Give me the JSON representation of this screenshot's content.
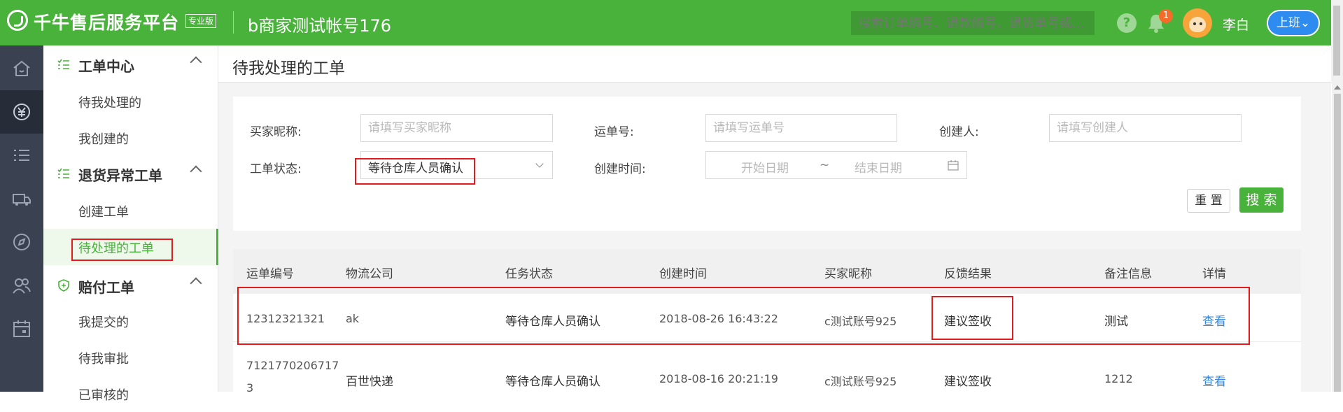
{
  "header": {
    "brand": "千牛售后服务平台",
    "edition": "专业版",
    "account": "b商家测试帐号176",
    "search_placeholder": "搜索订单编号、退款编号、退货单号或...",
    "help": "?",
    "notification_count": "1",
    "user_name": "李白",
    "shift_button": "上班",
    "colors": {
      "brand_green": "#49b23a",
      "shift_blue": "#2e8bf0",
      "badge": "#f56c2a"
    }
  },
  "rail": {
    "icons": [
      "home-icon",
      "yen-icon",
      "list-icon",
      "truck-icon",
      "compass-icon",
      "users-icon",
      "calendar-icon"
    ],
    "active_index": 1
  },
  "sidebar": {
    "groups": [
      {
        "label": "工单中心",
        "items": [
          "待我处理的",
          "我创建的"
        ]
      },
      {
        "label": "退货异常工单",
        "items": [
          "创建工单",
          "待处理的工单"
        ]
      },
      {
        "label": "赔付工单",
        "items": [
          "我提交的",
          "待我审批",
          "已审核的"
        ]
      }
    ],
    "active_item": "待处理的工单"
  },
  "main": {
    "title": "待我处理的工单",
    "filters": {
      "buyer_label": "买家昵称:",
      "buyer_placeholder": "请填写买家昵称",
      "waybill_label": "运单号:",
      "waybill_placeholder": "请填写运单号",
      "creator_label": "创建人:",
      "creator_placeholder": "请填写创建人",
      "status_label": "工单状态:",
      "status_value": "等待仓库人员确认",
      "time_label": "创建时间:",
      "start_placeholder": "开始日期",
      "range_sep": "~",
      "end_placeholder": "结束日期"
    },
    "buttons": {
      "reset": "重 置",
      "search": "搜 索"
    },
    "table": {
      "columns": [
        "运单编号",
        "物流公司",
        "任务状态",
        "创建时间",
        "买家昵称",
        "反馈结果",
        "备注信息",
        "详情"
      ],
      "rows": [
        [
          "12312321321",
          "ak",
          "等待仓库人员确认",
          "2018-08-26 16:43:22",
          "c测试账号925",
          "建议签收",
          "测试",
          "查看"
        ],
        [
          "7121770206717",
          "百世快递",
          "等待仓库人员确认",
          "2018-08-16 20:21:19",
          "c测试账号925",
          "建议签收",
          "1212",
          "查看"
        ]
      ],
      "row2_waybill_wrap": "3"
    }
  }
}
